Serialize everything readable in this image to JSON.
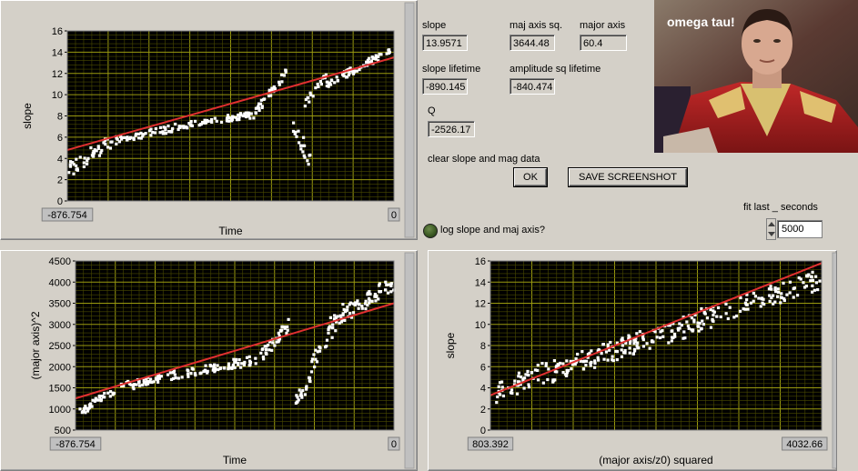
{
  "indicators": {
    "slope": {
      "label": "slope",
      "value": "13.9571"
    },
    "maj_axis_sq": {
      "label": "maj axis sq.",
      "value": "3644.48"
    },
    "major_axis": {
      "label": "major axis",
      "value": "60.4"
    },
    "slope_lifetime": {
      "label": "slope lifetime",
      "value": "-890.145"
    },
    "amplitude_sq_lifetime": {
      "label": "amplitude sq lifetime",
      "value": "-840.474"
    },
    "q": {
      "label": "Q",
      "value": "-2526.17"
    }
  },
  "controls": {
    "clear_label": "clear slope and mag data",
    "ok_button": "OK",
    "save_button": "SAVE SCREENSHOT",
    "log_label": "log slope and maj axis?",
    "fit_label": "fit last _ seconds",
    "fit_value": "5000"
  },
  "picture": {
    "caption": "omega tau!"
  },
  "colors": {
    "plot_bg": "#000000",
    "grid": "#8a8a00",
    "points": "#ffffff",
    "fit_line": "#e03030",
    "panel_bg": "#d4d0c8"
  },
  "chart_data": [
    {
      "type": "scatter",
      "id": "slope-vs-time",
      "title": "",
      "xlabel": "Time",
      "ylabel": "slope",
      "xlim": [
        -876.754,
        0
      ],
      "ylim": [
        0,
        16
      ],
      "x_tick_labels": [
        "-876.754",
        "0"
      ],
      "y_ticks": [
        0,
        2,
        4,
        6,
        8,
        10,
        12,
        14,
        16
      ],
      "fit": {
        "x": [
          -876.754,
          0
        ],
        "y": [
          4.8,
          13.5
        ]
      },
      "series": [
        {
          "segments": [
            {
              "x": [
                -876.754,
                -760
              ],
              "y": [
                2.8,
                5.6
              ],
              "n": 40,
              "jitter": 0.7
            },
            {
              "x": [
                -760,
                -520
              ],
              "y": [
                5.6,
                7.4
              ],
              "n": 70,
              "jitter": 0.35
            },
            {
              "x": [
                -520,
                -380
              ],
              "y": [
                7.4,
                8.1
              ],
              "n": 50,
              "jitter": 0.3
            },
            {
              "x": [
                -380,
                -290
              ],
              "y": [
                8.0,
                12.0
              ],
              "n": 35,
              "jitter": 0.4
            },
            {
              "x": [
                -270,
                -225
              ],
              "y": [
                7.5,
                3.8
              ],
              "n": 20,
              "jitter": 1.0
            },
            {
              "x": [
                -250,
                -180
              ],
              "y": [
                8.5,
                12.0
              ],
              "n": 20,
              "jitter": 0.4
            },
            {
              "x": [
                -180,
                0
              ],
              "y": [
                11.0,
                14.3
              ],
              "n": 70,
              "jitter": 0.35
            }
          ]
        }
      ]
    },
    {
      "type": "scatter",
      "id": "majaxis-vs-time",
      "title": "",
      "xlabel": "Time",
      "ylabel": "(major axis)^2",
      "xlim": [
        -876.754,
        0
      ],
      "ylim": [
        500,
        4500
      ],
      "x_tick_labels": [
        "-876.754",
        "0"
      ],
      "y_ticks": [
        500,
        1000,
        1500,
        2000,
        2500,
        3000,
        3500,
        4000,
        4500
      ],
      "fit": {
        "x": [
          -876.754,
          0
        ],
        "y": [
          1250,
          3500
        ]
      },
      "series": [
        {
          "segments": [
            {
              "x": [
                -876.754,
                -760
              ],
              "y": [
                850,
                1500
              ],
              "n": 40,
              "jitter": 90
            },
            {
              "x": [
                -760,
                -520
              ],
              "y": [
                1500,
                1950
              ],
              "n": 70,
              "jitter": 110
            },
            {
              "x": [
                -520,
                -380
              ],
              "y": [
                1950,
                2150
              ],
              "n": 50,
              "jitter": 110
            },
            {
              "x": [
                -380,
                -290
              ],
              "y": [
                2100,
                3000
              ],
              "n": 35,
              "jitter": 160
            },
            {
              "x": [
                -270,
                -225
              ],
              "y": [
                1200,
                1700
              ],
              "n": 20,
              "jitter": 150
            },
            {
              "x": [
                -230,
                -140
              ],
              "y": [
                2000,
                3300
              ],
              "n": 25,
              "jitter": 200
            },
            {
              "x": [
                -180,
                0
              ],
              "y": [
                3000,
                4000
              ],
              "n": 70,
              "jitter": 200
            }
          ]
        }
      ]
    },
    {
      "type": "scatter",
      "id": "slope-vs-majaxis",
      "title": "",
      "xlabel": "(major axis/z0) squared",
      "ylabel": "slope",
      "xlim": [
        803.392,
        4032.66
      ],
      "ylim": [
        0,
        16
      ],
      "x_tick_labels": [
        "803.392",
        "4032.66"
      ],
      "y_ticks": [
        0,
        2,
        4,
        6,
        8,
        10,
        12,
        14,
        16
      ],
      "fit": {
        "x": [
          803.392,
          4032.66
        ],
        "y": [
          3.3,
          15.8
        ]
      },
      "series": [
        {
          "segments": [
            {
              "x": [
                850,
                1400
              ],
              "y": [
                3.4,
                5.8
              ],
              "n": 50,
              "jitter": 1.0
            },
            {
              "x": [
                1400,
                2300
              ],
              "y": [
                5.5,
                8.5
              ],
              "n": 110,
              "jitter": 1.0
            },
            {
              "x": [
                2300,
                3000
              ],
              "y": [
                8.0,
                11.0
              ],
              "n": 70,
              "jitter": 1.1
            },
            {
              "x": [
                3000,
                4030
              ],
              "y": [
                11.0,
                14.2
              ],
              "n": 80,
              "jitter": 1.0
            }
          ]
        }
      ]
    }
  ]
}
